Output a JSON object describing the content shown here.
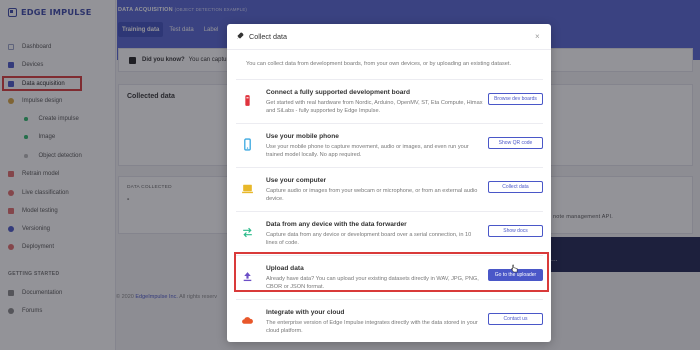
{
  "app": {
    "brand": "EDGE IMPULSE"
  },
  "sidebar": {
    "items": [
      {
        "label": "Dashboard",
        "icon": "dashboard-icon",
        "color": "#9aa3c8"
      },
      {
        "label": "Devices",
        "icon": "devices-icon",
        "color": "#4a57c8"
      },
      {
        "label": "Data acquisition",
        "icon": "data-icon",
        "color": "#4a57c8"
      },
      {
        "label": "Impulse design",
        "icon": "impulse-icon",
        "color": "#d9a640"
      },
      {
        "label": "Create impulse",
        "icon": "dot-icon",
        "color": "#2dbb6b"
      },
      {
        "label": "Image",
        "icon": "dot-icon",
        "color": "#2dbb6b"
      },
      {
        "label": "Object detection",
        "icon": "dot-icon",
        "color": "#bbbbbb"
      },
      {
        "label": "Retrain model",
        "icon": "retrain-icon",
        "color": "#e36b6b"
      },
      {
        "label": "Live classification",
        "icon": "live-icon",
        "color": "#e36b6b"
      },
      {
        "label": "Model testing",
        "icon": "testing-icon",
        "color": "#e36b6b"
      },
      {
        "label": "Versioning",
        "icon": "versioning-icon",
        "color": "#4a57c8"
      },
      {
        "label": "Deployment",
        "icon": "deployment-icon",
        "color": "#e36b6b"
      }
    ],
    "section": "GETTING STARTED",
    "getting_started": [
      {
        "label": "Documentation",
        "icon": "docs-icon"
      },
      {
        "label": "Forums",
        "icon": "forums-icon"
      }
    ]
  },
  "header": {
    "title": "DATA ACQUISITION",
    "subtitle": "(OBJECT DETECTION EXAMPLE)",
    "tabs": [
      "Training data",
      "Test data",
      "Label"
    ]
  },
  "tip": {
    "bold": "Did you know?",
    "text": "You can captur"
  },
  "collected": {
    "title": "Collected data"
  },
  "stats": {
    "label": "DATA COLLECTED",
    "value": "-"
  },
  "background_text": {
    "api_fragment": "note management API.",
    "ellipsis": "..."
  },
  "footer": {
    "copyright": "© 2020",
    "company": "EdgeImpulse Inc.",
    "rest": "All rights reserv"
  },
  "modal": {
    "title": "Collect data",
    "close": "×",
    "intro": "You can collect data from development boards, from your own devices, or by uploading an existing dataset.",
    "options": [
      {
        "title": "Connect a fully supported development board",
        "desc": "Get started with real hardware from Nordic, Arduino, OpenMV, ST, Eta Compute, Himax and SiLabs - fully supported by Edge Impulse.",
        "button": "Browse dev boards",
        "icon": "board-icon",
        "color": "#e0333d"
      },
      {
        "title": "Use your mobile phone",
        "desc": "Use your mobile phone to capture movement, audio or images, and even run your trained model locally. No app required.",
        "button": "Show QR code",
        "icon": "phone-icon",
        "color": "#3aa8e0"
      },
      {
        "title": "Use your computer",
        "desc": "Capture audio or images from your webcam or microphone, or from an external audio device.",
        "button": "Collect data",
        "icon": "laptop-icon",
        "color": "#e8b82a"
      },
      {
        "title": "Data from any device with the data forwarder",
        "desc": "Capture data from any device or development board over a serial connection, in 10 lines of code.",
        "button": "Show docs",
        "icon": "forwarder-icon",
        "color": "#2dbb8b"
      },
      {
        "title": "Upload data",
        "desc": "Already have data? You can upload your existing datasets directly in WAV, JPG, PNG, CBOR or JSON format.",
        "button": "Go to the uploader",
        "icon": "upload-icon",
        "color": "#6c4fc7"
      },
      {
        "title": "Integrate with your cloud",
        "desc": "The enterprise version of Edge Impulse integrates directly with the data stored in your cloud platform.",
        "button": "Contact us",
        "icon": "cloud-icon",
        "color": "#e8572a"
      }
    ]
  }
}
